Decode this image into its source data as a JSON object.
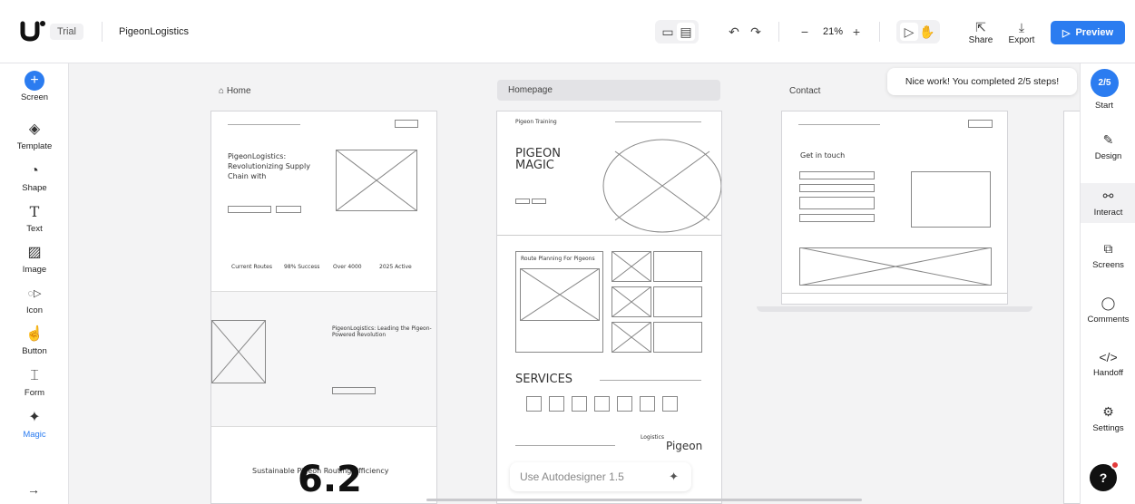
{
  "topbar": {
    "trial_label": "Trial",
    "project_name": "PigeonLogistics",
    "zoom_level": "21%",
    "share_label": "Share",
    "export_label": "Export",
    "preview_label": "Preview"
  },
  "sidebar": {
    "items": [
      {
        "label": "Screen",
        "icon": "plus-icon"
      },
      {
        "label": "Template",
        "icon": "layers-icon"
      },
      {
        "label": "Shape",
        "icon": "shape-icon"
      },
      {
        "label": "Text",
        "icon": "text-icon"
      },
      {
        "label": "Image",
        "icon": "image-icon"
      },
      {
        "label": "Icon",
        "icon": "icon-icon"
      },
      {
        "label": "Button",
        "icon": "button-icon"
      },
      {
        "label": "Form",
        "icon": "form-icon"
      },
      {
        "label": "Magic",
        "icon": "sparkle-icon"
      }
    ]
  },
  "rightbar": {
    "items": [
      {
        "label": "Design",
        "icon": "pen-icon"
      },
      {
        "label": "Interact",
        "icon": "interact-icon"
      },
      {
        "label": "Screens",
        "icon": "screens-icon"
      },
      {
        "label": "Comments",
        "icon": "comment-icon"
      },
      {
        "label": "Handoff",
        "icon": "code-icon"
      },
      {
        "label": "Settings",
        "icon": "gear-icon"
      }
    ]
  },
  "steps": {
    "badge": "2/5",
    "start_label": "Start",
    "toast": "Nice work! You completed 2/5 steps!"
  },
  "frames": {
    "home_label": "Home",
    "homepage_label": "Homepage",
    "contact_label": "Contact",
    "home": {
      "hero_title": "PigeonLogistics: Revolutionizing Supply Chain with",
      "stats": [
        "Current Routes",
        "98% Success",
        "Over 4000",
        "2025 Active"
      ],
      "section_title": "PigeonLogistics: Leading the Pigeon-Powered Revolution",
      "footer_title": "Sustainable Pigeon Routing Efficiency"
    },
    "homepage": {
      "brand": "Pigeon Training",
      "hero_title": "PIGEON MAGIC",
      "route_title": "Route Planning For Pigeons",
      "services_title": "SERVICES",
      "pigeon_word": "Pigeon",
      "logistics_word": "Logistics"
    },
    "contact": {
      "title": "Get in touch"
    }
  },
  "autodesigner": {
    "placeholder": "Use Autodesigner 1.5"
  },
  "scribble": "6.2"
}
